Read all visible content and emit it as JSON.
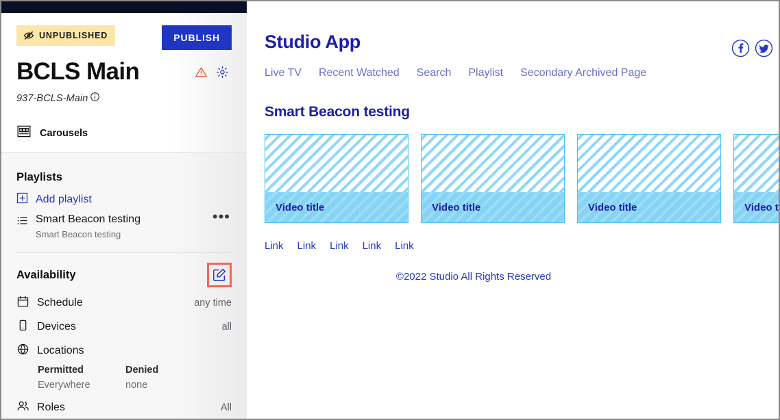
{
  "sidebar": {
    "status_badge": {
      "label": "UNPUBLISHED",
      "icon": "eye-slash-icon",
      "bg_color": "#fbe6a8"
    },
    "publish_button": {
      "label": "PUBLISH",
      "bg_color": "#1f35c4"
    },
    "page_title": "BCLS Main",
    "title_icons": [
      {
        "name": "warning-triangle-icon",
        "color": "#e8552c"
      },
      {
        "name": "gear-icon",
        "color": "#1f35c4"
      }
    ],
    "slug": "937-BCLS-Main",
    "slug_info_icon": "info-circle-icon",
    "carousels": {
      "label": "Carousels",
      "icon": "carousel-icon"
    },
    "playlists": {
      "heading": "Playlists",
      "add_label": "Add playlist",
      "add_icon": "plus-square-icon",
      "items": [
        {
          "icon": "list-icon",
          "name": "Smart Beacon testing",
          "subtitle": "Smart Beacon testing",
          "menu": "•••"
        }
      ]
    },
    "availability": {
      "heading": "Availability",
      "edit_icon": "edit-square-icon",
      "edit_highlight_color": "#f2655a",
      "rows": [
        {
          "icon": "calendar-icon",
          "label": "Schedule",
          "value": "any time"
        },
        {
          "icon": "device-phone-icon",
          "label": "Devices",
          "value": "all"
        },
        {
          "icon": "globe-icon",
          "label": "Locations",
          "value": ""
        }
      ],
      "locations": {
        "permitted_header": "Permitted",
        "permitted_value": "Everywhere",
        "denied_header": "Denied",
        "denied_value": "none"
      },
      "roles": {
        "icon": "users-icon",
        "label": "Roles",
        "value": "All"
      }
    }
  },
  "preview": {
    "app_title": "Studio App",
    "social": [
      {
        "name": "facebook-icon",
        "glyph": "f"
      },
      {
        "name": "twitter-icon",
        "glyph": "t"
      }
    ],
    "nav": [
      {
        "label": "Live TV"
      },
      {
        "label": "Recent Watched"
      },
      {
        "label": "Search"
      },
      {
        "label": "Playlist"
      },
      {
        "label": "Secondary Archived Page"
      }
    ],
    "section_title": "Smart Beacon testing",
    "cards": [
      {
        "title": "Video title"
      },
      {
        "title": "Video title"
      },
      {
        "title": "Video title"
      },
      {
        "title": "Video title"
      }
    ],
    "footer_links": [
      {
        "label": "Link"
      },
      {
        "label": "Link"
      },
      {
        "label": "Link"
      },
      {
        "label": "Link"
      },
      {
        "label": "Link"
      }
    ],
    "copyright": "©2022 Studio All Rights Reserved",
    "accent_color": "#1d1fa8",
    "link_color": "#2438c8",
    "nav_color": "#6a6ec9",
    "card_color": "#4cc3f2"
  }
}
